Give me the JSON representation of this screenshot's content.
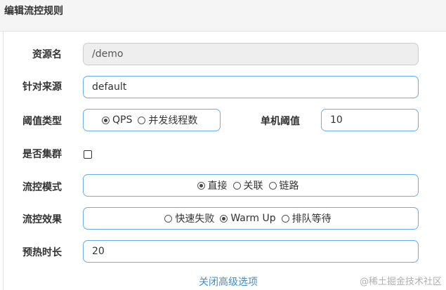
{
  "dialog": {
    "title": "编辑流控规则"
  },
  "form": {
    "resource_name": {
      "label": "资源名",
      "value": "/demo"
    },
    "limit_app": {
      "label": "针对来源",
      "value": "default"
    },
    "grade": {
      "label": "阈值类型",
      "options": [
        "QPS",
        "并发线程数"
      ],
      "selected": "QPS"
    },
    "count": {
      "label": "单机阈值",
      "value": "10"
    },
    "cluster": {
      "label": "是否集群",
      "checked": false
    },
    "strategy": {
      "label": "流控模式",
      "options": [
        "直接",
        "关联",
        "链路"
      ],
      "selected": "直接"
    },
    "control_behavior": {
      "label": "流控效果",
      "options": [
        "快速失败",
        "Warm Up",
        "排队等待"
      ],
      "selected": "Warm Up"
    },
    "warm_up_period": {
      "label": "预热时长",
      "value": "20"
    },
    "advanced_toggle": "关闭高级选项"
  },
  "watermark": "@稀土掘金技术社区"
}
